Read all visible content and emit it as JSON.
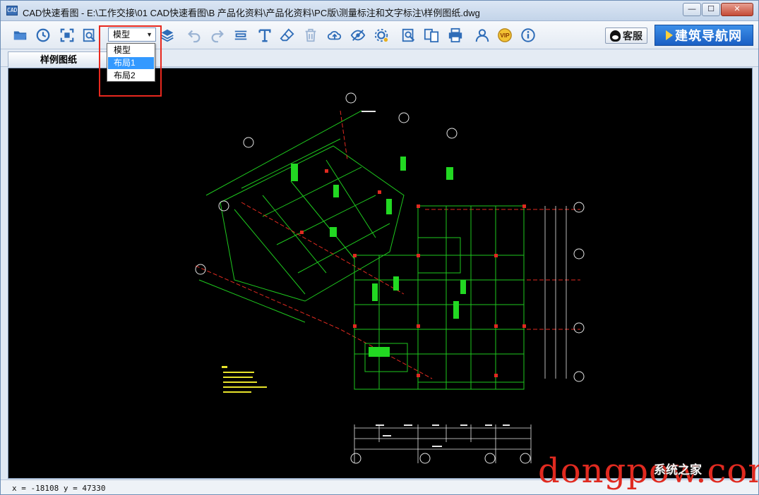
{
  "window": {
    "app_icon_text": "CAD",
    "title": "CAD快速看图 - E:\\工作交接\\01 CAD快速看图\\B 产品化资料\\产品化资料\\PC版\\测量标注和文字标注\\样例图纸.dwg",
    "minimize_label": "—",
    "maximize_label": "☐",
    "close_label": "✕"
  },
  "toolbar": {
    "layout_select": {
      "value": "模型"
    },
    "icons": [
      "open-folder-icon",
      "history-clock-icon",
      "fit-view-icon",
      "zoom-window-icon",
      "layers-icon",
      "undo-icon",
      "redo-icon",
      "measure-icon",
      "text-icon",
      "eraser-icon",
      "delete-icon",
      "cloud-upload-icon",
      "eye-hide-icon",
      "settings-icon",
      "find-icon",
      "compare-icon",
      "print-icon",
      "user-icon",
      "vip-badge-icon",
      "info-icon"
    ],
    "vip_label": "VIP",
    "service_label": "客服",
    "nav_banner": "建筑导航网"
  },
  "layout_dropdown": {
    "options": [
      {
        "label": "模型",
        "selected": false
      },
      {
        "label": "布局1",
        "selected": true
      },
      {
        "label": "布局2",
        "selected": false
      }
    ]
  },
  "tabs": [
    {
      "label": "样例图纸"
    }
  ],
  "statusbar": {
    "coord": "x = -18108  y = 47330"
  },
  "watermark": {
    "text": "dongpow.com",
    "overlay": "系统之家"
  },
  "drawing_colors": {
    "background": "#000000",
    "axis": "#1ec81e",
    "beam": "#1ec81e",
    "dim": "#e6e6e6",
    "cut": "#e02a20",
    "note": "#e8e32a",
    "label": "#22d822"
  }
}
